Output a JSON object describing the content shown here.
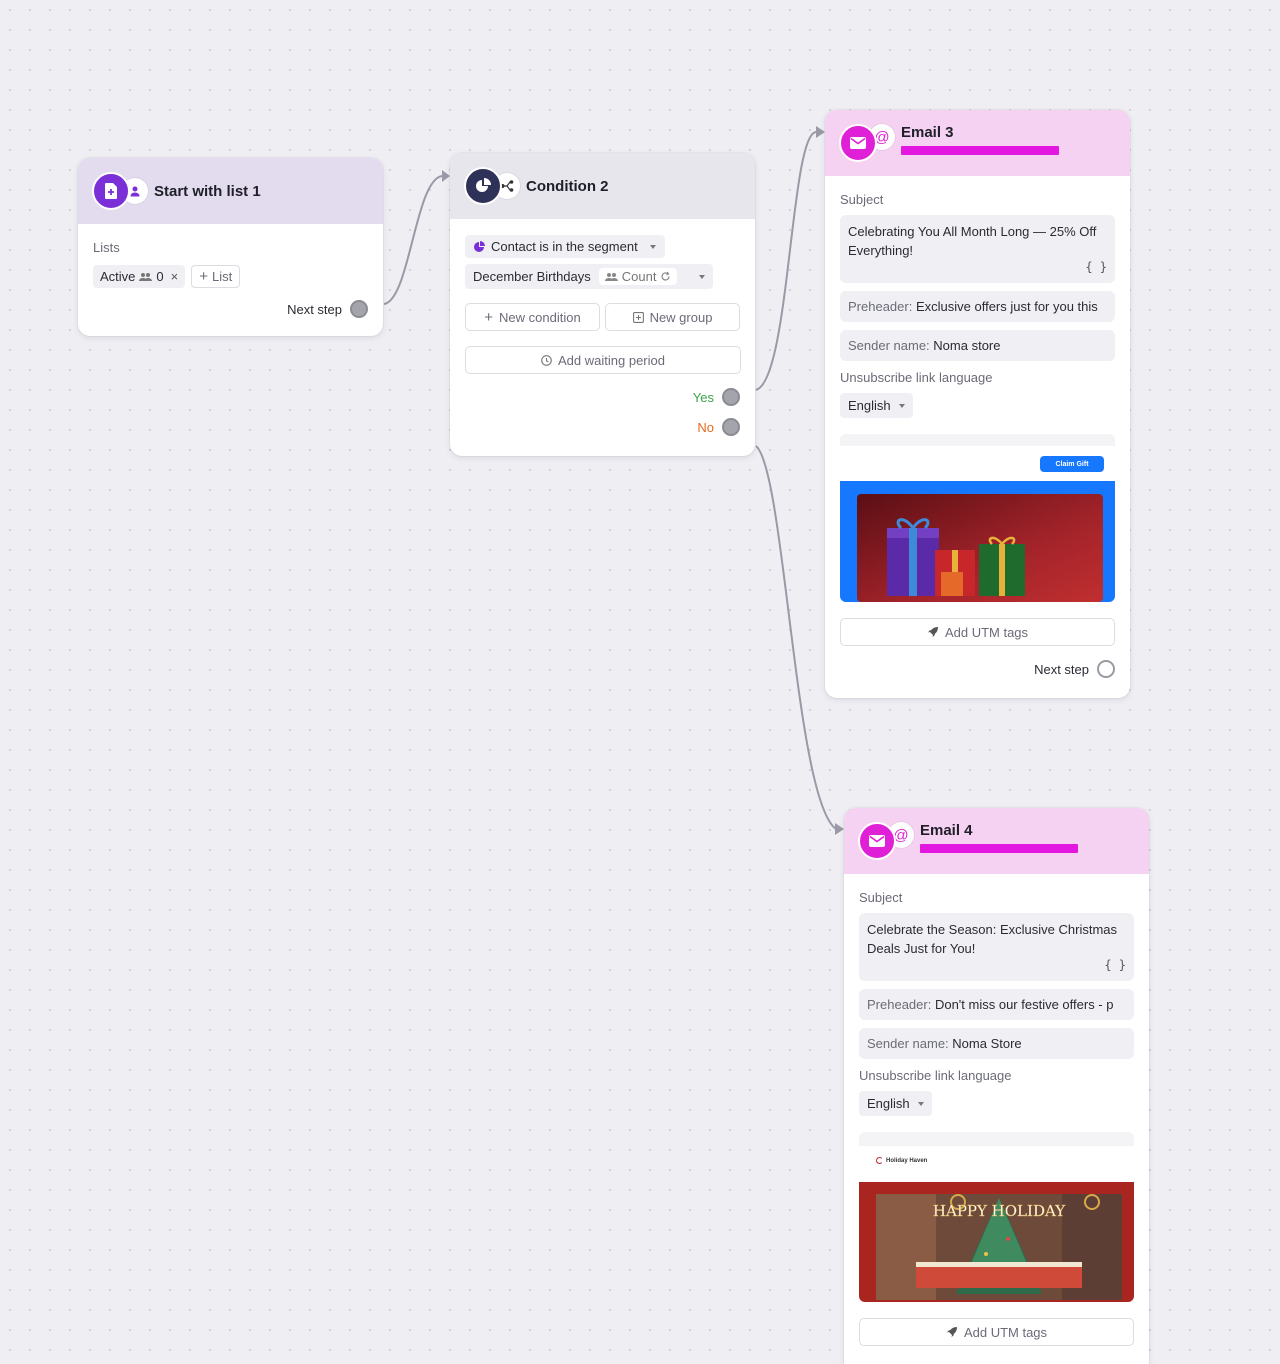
{
  "start": {
    "title": "Start with list 1",
    "lists_label": "Lists",
    "list_chip": {
      "name": "Active",
      "count": "0",
      "remove": "×"
    },
    "add_list": "List",
    "next_step": "Next step"
  },
  "condition": {
    "title": "Condition 2",
    "rule": "Contact is in the segment",
    "segment": "December Birthdays",
    "count": "Count",
    "new_condition": "New condition",
    "new_group": "New group",
    "add_waiting": "Add waiting period",
    "yes": "Yes",
    "no": "No"
  },
  "email3": {
    "title": "Email 3",
    "subject_label": "Subject",
    "subject": "Celebrating You All Month Long — 25% Off Everything!",
    "braces": "{ }",
    "preheader_key": "Preheader:",
    "preheader": "Exclusive offers just for you this",
    "sender_key": "Sender name:",
    "sender": "Noma store",
    "unsub_label": "Unsubscribe link language",
    "language": "English",
    "preview_button": "Claim Gift",
    "utm": "Add UTM tags",
    "next_step": "Next step"
  },
  "email4": {
    "title": "Email 4",
    "subject_label": "Subject",
    "subject": "Celebrate the Season: Exclusive Christmas Deals Just for You!",
    "braces": "{ }",
    "preheader_key": "Preheader:",
    "preheader": "Don't miss our festive offers - p",
    "sender_key": "Sender name:",
    "sender": "Noma Store",
    "unsub_label": "Unsubscribe link language",
    "language": "English",
    "preview_brand": "Holiday Haven",
    "preview_banner": "HAPPY HOLIDAY",
    "utm": "Add UTM tags"
  },
  "colors": {
    "accent_purple": "#7b2fd6",
    "email_pink": "#e020d6",
    "yes_green": "#3aa548",
    "no_orange": "#e36a1f",
    "redaction": "#e318e0"
  }
}
